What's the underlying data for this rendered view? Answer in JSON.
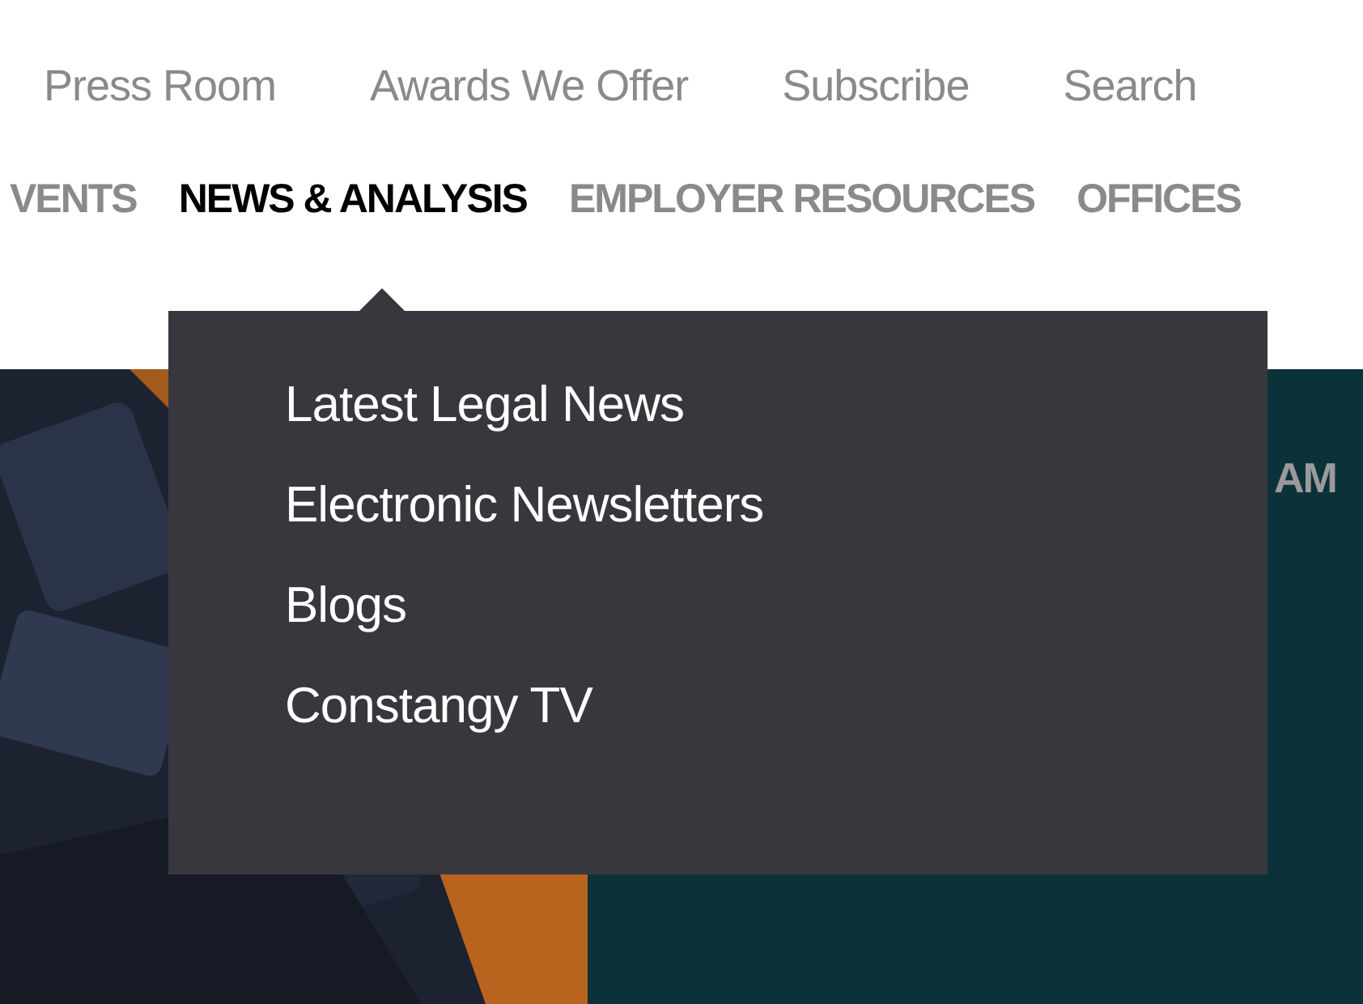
{
  "utility_links": [
    "Press Room",
    "Awards We Offer",
    "Subscribe",
    "Search"
  ],
  "main_nav": [
    {
      "label": "VENTS",
      "selected": false
    },
    {
      "label": "NEWS & ANALYSIS",
      "selected": true
    },
    {
      "label": "EMPLOYER RESOURCES",
      "selected": false
    },
    {
      "label": "OFFICES",
      "selected": false
    }
  ],
  "dropdown": {
    "items": [
      "Latest Legal News",
      "Electronic Newsletters",
      "Blogs",
      "Constangy TV"
    ]
  },
  "hero": {
    "right_heading": "AM"
  }
}
